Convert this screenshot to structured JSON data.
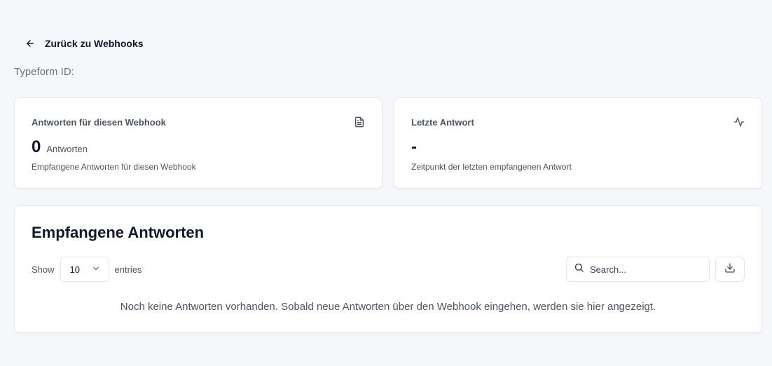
{
  "header": {
    "back_label": "Zurück zu Webhooks",
    "typeform_label": "Typeform ID:"
  },
  "stats": [
    {
      "title": "Antworten für diesen Webhook",
      "icon": "document-icon",
      "value": "0",
      "unit": "Antworten",
      "subtitle": "Empfangene Antworten für diesen Webhook"
    },
    {
      "title": "Letzte Antwort",
      "icon": "activity-icon",
      "value": "-",
      "subtitle": "Zeitpunkt der letzten empfangenen Antwort"
    }
  ],
  "table": {
    "title": "Empfangene Antworten",
    "show_label": "Show",
    "page_size": "10",
    "entries_label": "entries",
    "search_placeholder": "Search...",
    "empty_message": "Noch keine Antworten vorhanden. Sobald neue Antworten über den Webhook eingehen, werden sie hier angezeigt."
  },
  "colors": {
    "background": "#f6f7fa",
    "card": "#ffffff",
    "border": "#e5e7eb",
    "text_primary": "#111827",
    "text_secondary": "#4b5563"
  }
}
